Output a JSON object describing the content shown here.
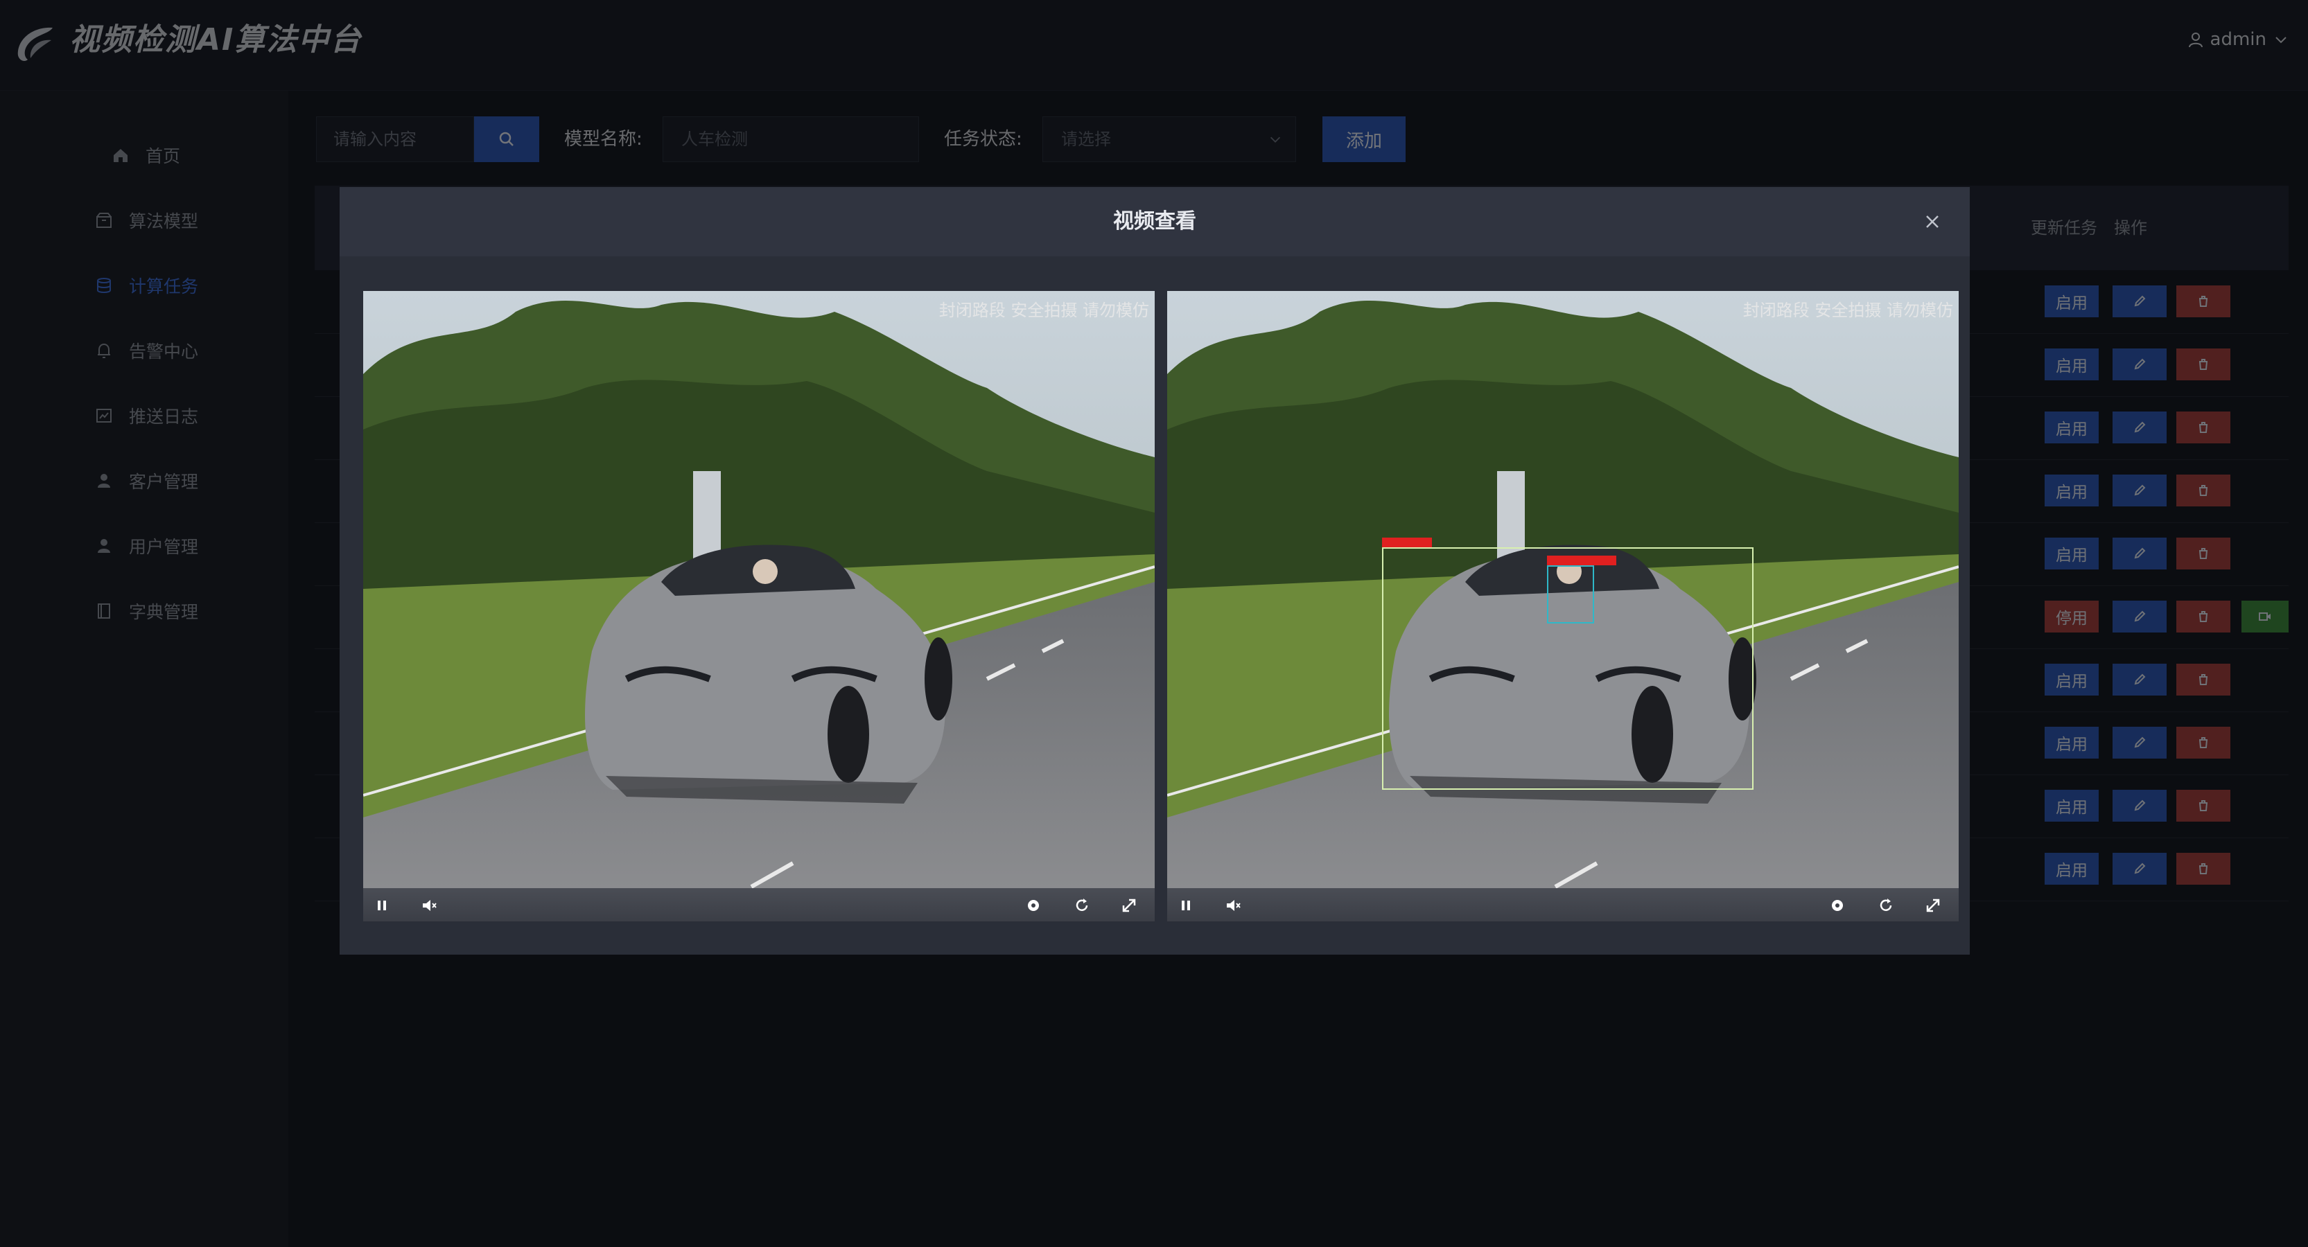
{
  "header": {
    "app_title": "视频检测AI算法中台",
    "user_name": "admin",
    "logo": "swirl-logo",
    "user_icon": "user-icon",
    "dropdown_icon": "chevron-down-icon"
  },
  "sidebar": {
    "items": [
      {
        "label": "首页",
        "icon": "home-icon",
        "active": false
      },
      {
        "label": "算法模型",
        "icon": "package-icon",
        "active": false
      },
      {
        "label": "计算任务",
        "icon": "database-icon",
        "active": true
      },
      {
        "label": "告警中心",
        "icon": "bell-icon",
        "active": false
      },
      {
        "label": "推送日志",
        "icon": "chart-icon",
        "active": false
      },
      {
        "label": "客户管理",
        "icon": "person-icon",
        "active": false
      },
      {
        "label": "用户管理",
        "icon": "person-icon",
        "active": false
      },
      {
        "label": "字典管理",
        "icon": "book-icon",
        "active": false
      }
    ]
  },
  "toolbar": {
    "search_placeholder": "请输入内容",
    "model_label": "模型名称:",
    "model_placeholder": "人车检测",
    "status_label": "任务状态:",
    "status_placeholder": "请选择",
    "add_label": "添加"
  },
  "table": {
    "headers": [
      "更新任务",
      "操作"
    ],
    "rows": [
      {
        "status_button": "启用",
        "state": "enable"
      },
      {
        "status_button": "启用",
        "state": "enable"
      },
      {
        "status_button": "启用",
        "state": "enable"
      },
      {
        "status_button": "启用",
        "state": "enable"
      },
      {
        "status_button": "启用",
        "state": "enable"
      },
      {
        "status_button": "停用",
        "state": "stop"
      },
      {
        "status_button": "启用",
        "state": "enable"
      },
      {
        "status_button": "启用",
        "state": "enable"
      },
      {
        "status_button": "启用",
        "state": "enable"
      },
      {
        "status_button": "启用",
        "state": "enable"
      }
    ]
  },
  "dialog": {
    "title": "视频查看",
    "players": [
      {
        "watermark": "封闭路段 安全拍摄 请勿模仿"
      },
      {
        "watermark": "封闭路段 安全拍摄 请勿模仿"
      }
    ]
  },
  "colors": {
    "accent": "#2e58b5",
    "danger": "#a3413f",
    "success": "#3e8a3e",
    "background": "#161a23"
  }
}
